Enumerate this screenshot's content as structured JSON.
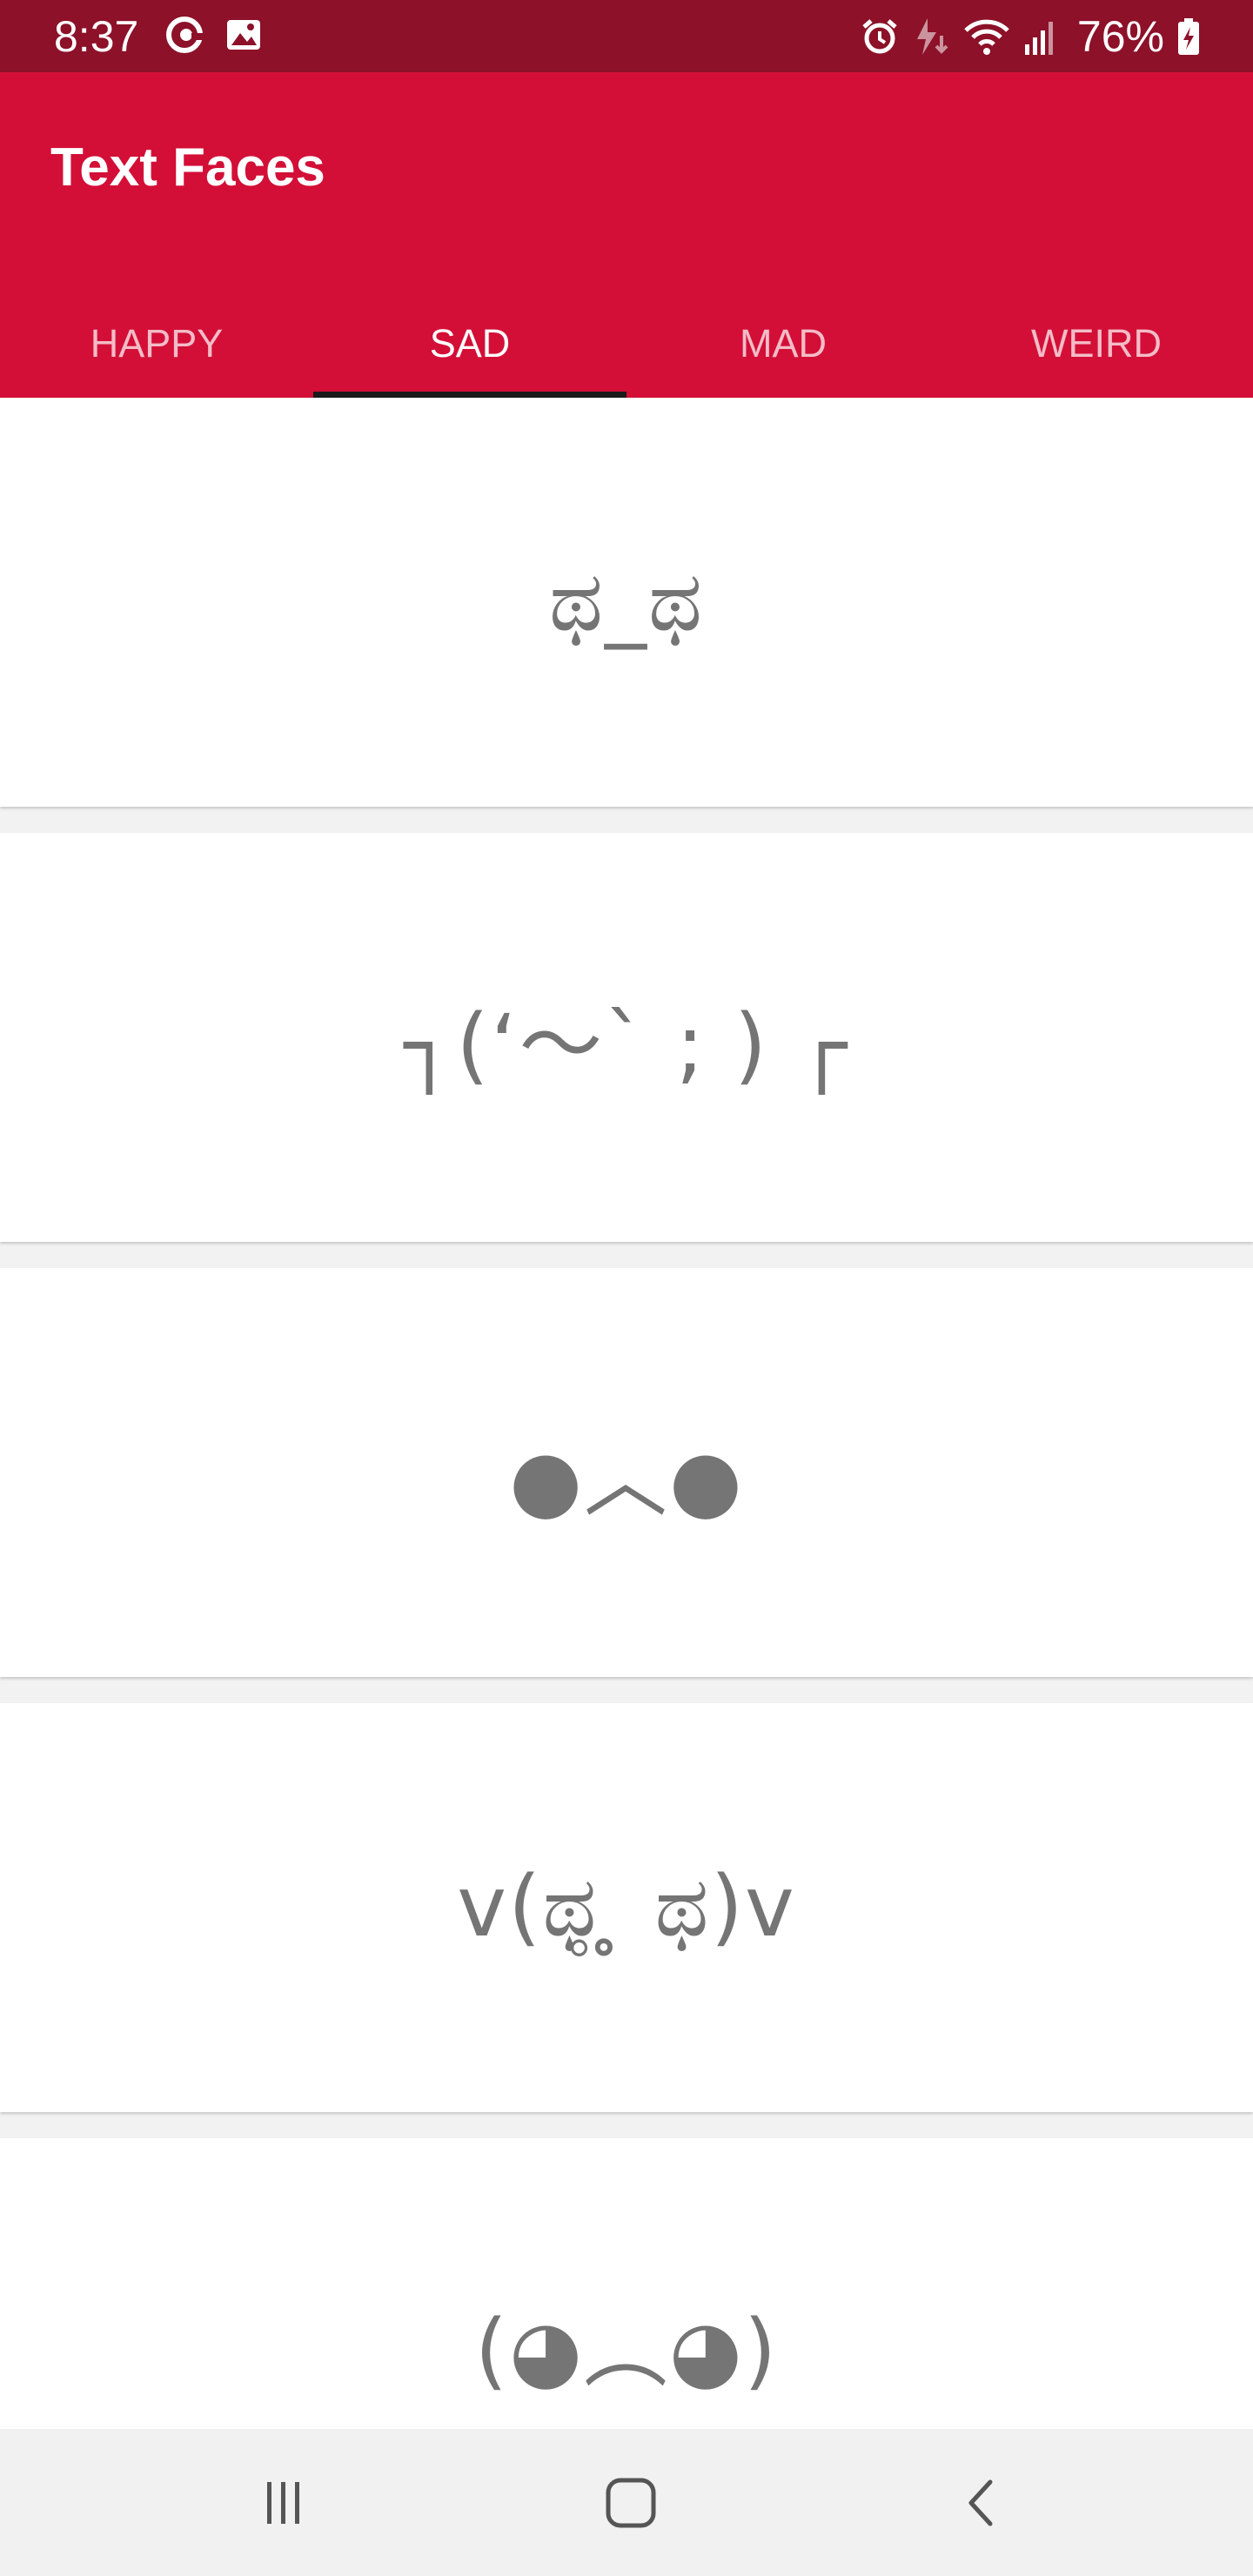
{
  "status_bar": {
    "time": "8:37",
    "battery": "76%",
    "icons": [
      "at-sign-icon",
      "image-icon",
      "alarm-icon",
      "data-saver-icon",
      "wifi-icon",
      "signal-icon",
      "battery-charging-icon"
    ]
  },
  "app": {
    "title": "Text Faces"
  },
  "tabs": [
    {
      "label": "HAPPY",
      "active": false
    },
    {
      "label": "SAD",
      "active": true
    },
    {
      "label": "MAD",
      "active": false
    },
    {
      "label": "WEIRD",
      "active": false
    }
  ],
  "faces": [
    "ಥ_ಥ",
    "┐(‘～` ; ) ┌",
    "●︿●",
    "v(ಥ̥ ̥ ಥ)v",
    "(◕︵◕)"
  ],
  "nav": {
    "icons": [
      "recent-apps-icon",
      "home-icon",
      "back-icon"
    ]
  },
  "colors": {
    "status_bar": "#8c1129",
    "primary": "#d30f37",
    "tab_indicator": "#1a1a1a",
    "face_text": "#757575",
    "nav_bar": "#f1f1f1"
  }
}
